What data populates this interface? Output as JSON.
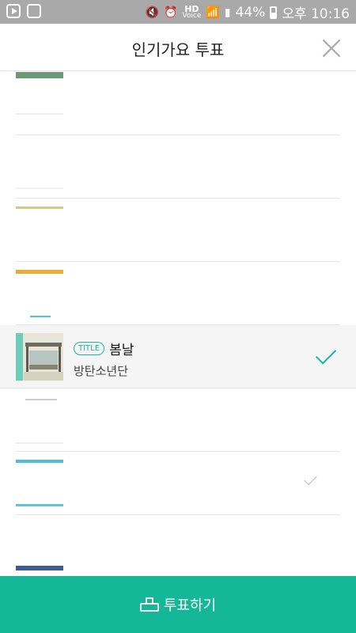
{
  "status_bar": {
    "battery": "44%",
    "time": "오후 10:16",
    "hd_label": "HD",
    "voice_label": "Voice"
  },
  "header": {
    "title": "인기가요 투표"
  },
  "list": {
    "selected": {
      "badge": "TITLE",
      "song": "봄날",
      "artist": "방탄소년단"
    }
  },
  "vote_button": {
    "label": "투표하기"
  },
  "colors": {
    "accent": "#19b89b",
    "status_bar": "#a9a9a9"
  }
}
